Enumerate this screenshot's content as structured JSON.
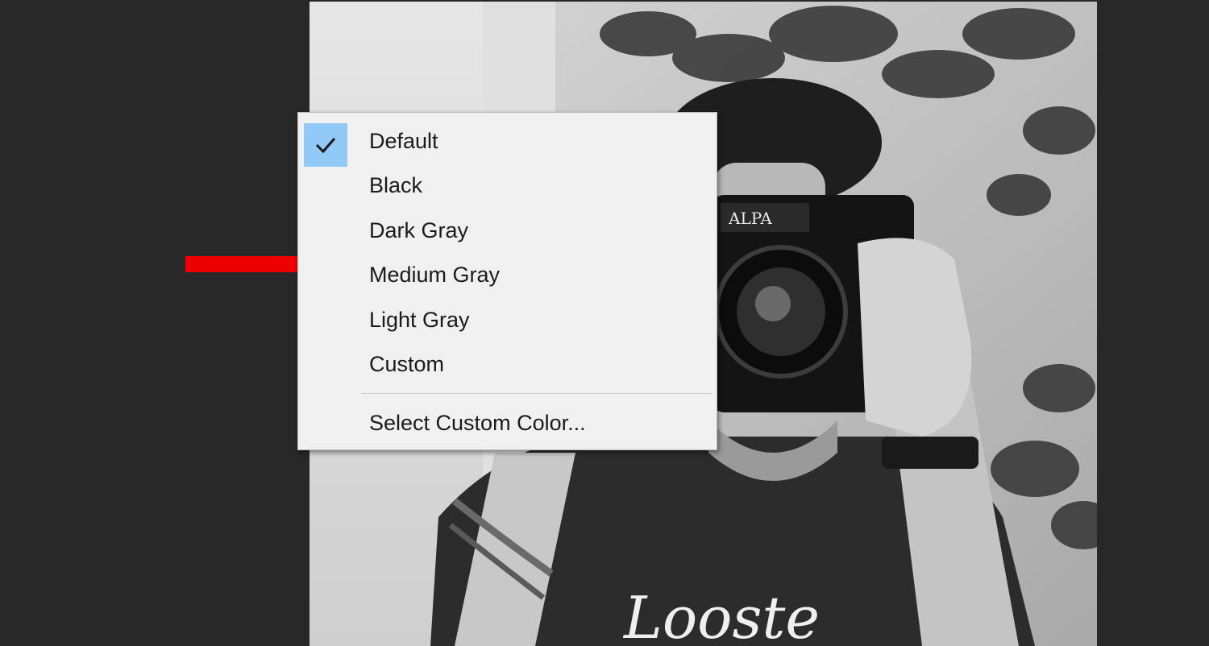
{
  "colors": {
    "app_background": "#282828",
    "menu_background": "#f0f0f0",
    "check_highlight": "#91c9f7",
    "annotation_arrow": "#ee0000"
  },
  "document": {
    "image_description_icon": "grayscale-photo",
    "camera_brand_text": "ALPA",
    "shirt_text": "Looste"
  },
  "context_menu": {
    "checked_item": "Default",
    "items": [
      {
        "label": "Default",
        "checked": true
      },
      {
        "label": "Black",
        "checked": false
      },
      {
        "label": "Dark Gray",
        "checked": false
      },
      {
        "label": "Medium Gray",
        "checked": false
      },
      {
        "label": "Light Gray",
        "checked": false
      },
      {
        "label": "Custom",
        "checked": false
      }
    ],
    "footer_item": {
      "label": "Select Custom Color..."
    }
  },
  "annotation": {
    "icon": "red-arrow-icon",
    "points_to": "Medium Gray"
  }
}
